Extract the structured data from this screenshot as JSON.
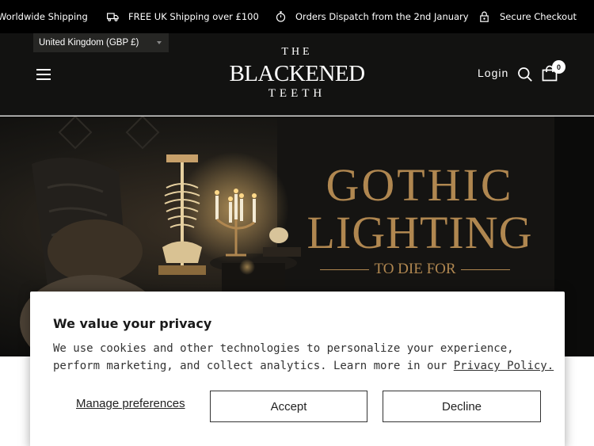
{
  "announcement": {
    "items": [
      {
        "text": "Worldwide Shipping",
        "icon": "globe-icon"
      },
      {
        "text": "FREE UK Shipping over £100",
        "icon": "truck-icon"
      },
      {
        "text": "Orders Dispatch from the 2nd January",
        "icon": "stopwatch-icon"
      },
      {
        "text": "Secure Checkout",
        "icon": "lock-icon"
      }
    ]
  },
  "header": {
    "country_selector": "United Kingdom (GBP £)",
    "logo": {
      "line1": "THE",
      "line2": "BLACKENED",
      "line3": "TEETH"
    },
    "login_label": "Login",
    "cart_count": "0"
  },
  "hero": {
    "headline_line1": "GOTHIC",
    "headline_line2": "LIGHTING",
    "tagline": "TO DIE FOR",
    "accent_color": "#b08750"
  },
  "cookie_banner": {
    "title": "We value your privacy",
    "body": "We use cookies and other technologies to personalize your experience, perform marketing, and collect analytics. Learn more in our",
    "policy_link": "Privacy Policy.",
    "manage_label": "Manage preferences",
    "accept_label": "Accept",
    "decline_label": "Decline"
  }
}
